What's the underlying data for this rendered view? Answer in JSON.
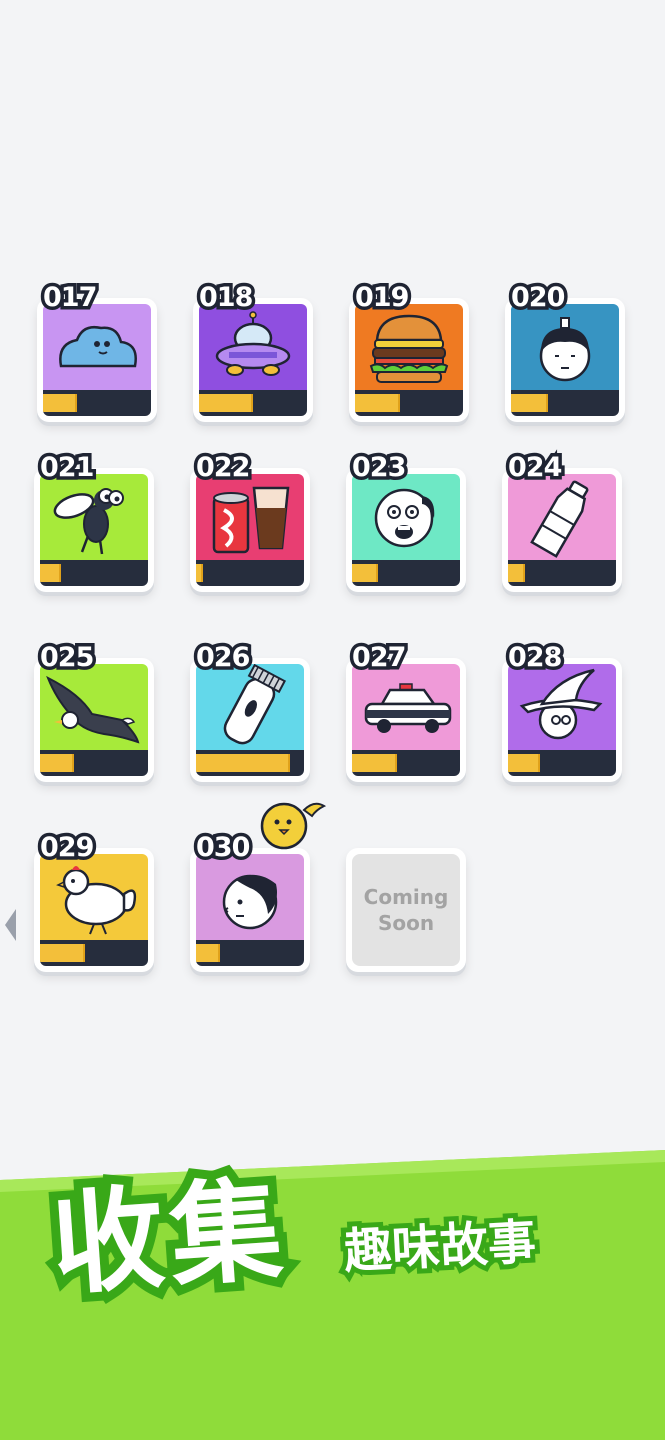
{
  "cards": [
    {
      "number": "017",
      "bg": "#c895f2",
      "progress": 0.3,
      "icon": "blob-icon"
    },
    {
      "number": "018",
      "bg": "#8f4fe0",
      "progress": 0.48,
      "icon": "ufo-icon"
    },
    {
      "number": "019",
      "bg": "#ef7a22",
      "progress": 0.4,
      "icon": "burger-icon"
    },
    {
      "number": "020",
      "bg": "#3794c2",
      "progress": 0.32,
      "icon": "man-face-icon"
    },
    {
      "number": "021",
      "bg": "#a7ea3a",
      "progress": 0.18,
      "icon": "fly-icon"
    },
    {
      "number": "022",
      "bg": "#e83e72",
      "progress": 0.05,
      "icon": "soda-drink-icon"
    },
    {
      "number": "023",
      "bg": "#6ee8c5",
      "progress": 0.22,
      "icon": "shocked-face-icon"
    },
    {
      "number": "024",
      "bg": "#ef9ad8",
      "progress": 0.14,
      "icon": "water-bottle-icon"
    },
    {
      "number": "025",
      "bg": "#a7ea3a",
      "progress": 0.3,
      "icon": "eagle-icon"
    },
    {
      "number": "026",
      "bg": "#63d8ea",
      "progress": 0.85,
      "icon": "hair-clipper-icon"
    },
    {
      "number": "027",
      "bg": "#ef9ad8",
      "progress": 0.4,
      "icon": "police-car-icon"
    },
    {
      "number": "028",
      "bg": "#b06cea",
      "progress": 0.28,
      "icon": "witch-icon"
    },
    {
      "number": "029",
      "bg": "#f4c93a",
      "progress": 0.4,
      "icon": "chicken-icon"
    },
    {
      "number": "030",
      "bg": "#d99ae0",
      "progress": 0.2,
      "icon": "profile-face-icon"
    }
  ],
  "coming_soon": {
    "line1": "Coming",
    "line2": "Soon"
  },
  "banner": {
    "title": "收集",
    "subtitle": "趣味故事"
  },
  "colors": {
    "bar_bg": "#262d3d",
    "bar_fill": "#f3bf3a",
    "banner_green": "#8fdc3a"
  }
}
